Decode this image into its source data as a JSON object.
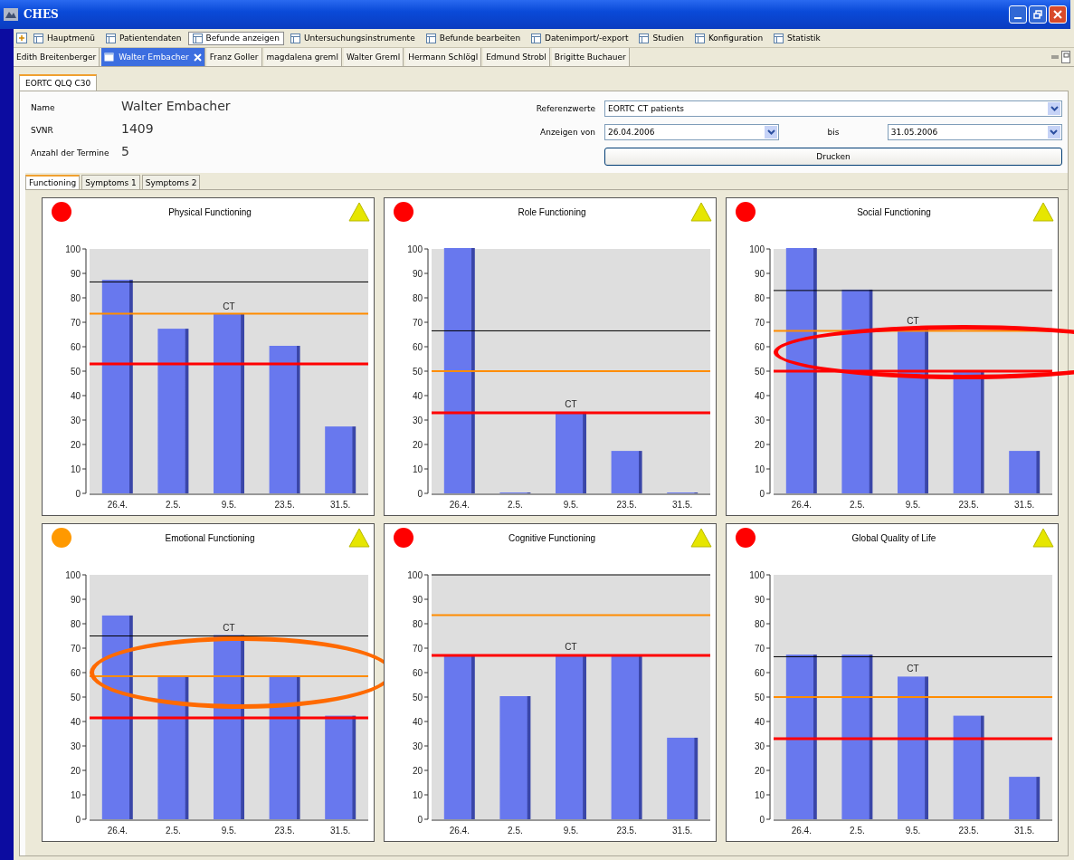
{
  "window": {
    "title": "CHES"
  },
  "toolbar": [
    {
      "label": "Hauptmenü",
      "selected": false
    },
    {
      "label": "Patientendaten",
      "selected": false
    },
    {
      "label": "Befunde anzeigen",
      "selected": true
    },
    {
      "label": "Untersuchungsinstrumente",
      "selected": false
    },
    {
      "label": "Befunde bearbeiten",
      "selected": false
    },
    {
      "label": "Datenimport/-export",
      "selected": false
    },
    {
      "label": "Studien",
      "selected": false
    },
    {
      "label": "Konfiguration",
      "selected": false
    },
    {
      "label": "Statistik",
      "selected": false
    }
  ],
  "patient_tabs": [
    {
      "label": "Edith Breitenberger",
      "selected": false
    },
    {
      "label": "Walter Embacher",
      "selected": true
    },
    {
      "label": "Franz Goller",
      "selected": false
    },
    {
      "label": "magdalena greml",
      "selected": false
    },
    {
      "label": "Walter Greml",
      "selected": false
    },
    {
      "label": "Hermann Schlögl",
      "selected": false
    },
    {
      "label": "Edmund Strobl",
      "selected": false
    },
    {
      "label": "Brigitte Buchauer",
      "selected": false
    }
  ],
  "document_tab": {
    "label": "EORTC QLQ C30"
  },
  "patient_fields": [
    {
      "label": "Name",
      "value": "Walter Embacher"
    },
    {
      "label": "SVNR",
      "value": "1409"
    },
    {
      "label": "Anzahl der Termine",
      "value": "5"
    }
  ],
  "filters": {
    "reference": {
      "label": "Referenzwerte",
      "value": "EORTC CT patients"
    },
    "from": {
      "label": "Anzeigen von",
      "value": "26.04.2006"
    },
    "to": {
      "label": "bis",
      "value": "31.05.2006"
    },
    "print_button": "Drucken"
  },
  "sub_tabs": [
    {
      "label": "Functioning",
      "selected": true
    },
    {
      "label": "Symptoms 1",
      "selected": false
    },
    {
      "label": "Symptoms 2",
      "selected": false
    }
  ],
  "charts": [
    {
      "color": "#ff0000",
      "chart_data": {
        "type": "bar",
        "title": "Physical Functioning",
        "categories": [
          "26.4.",
          "2.5.",
          "9.5.",
          "23.5.",
          "31.5."
        ],
        "values": [
          87,
          67,
          73,
          60,
          27
        ],
        "ylim": [
          0,
          100
        ],
        "yticks": [
          0,
          10,
          20,
          30,
          40,
          50,
          60,
          70,
          80,
          90,
          100
        ],
        "ref_lines": [
          {
            "axis": "y",
            "value": 86.5,
            "color": "#000000"
          },
          {
            "axis": "y",
            "value": 73.5,
            "color": "#ff8c00"
          },
          {
            "axis": "y",
            "value": 53,
            "color": "#ff0000"
          }
        ],
        "annotations": [
          {
            "x": "9.5.",
            "y": 73,
            "text": "CT"
          }
        ]
      }
    },
    {
      "color": "#ff0000",
      "chart_data": {
        "type": "bar",
        "title": "Role Functioning",
        "categories": [
          "26.4.",
          "2.5.",
          "9.5.",
          "23.5.",
          "31.5."
        ],
        "values": [
          100,
          0,
          33,
          17,
          0
        ],
        "ylim": [
          0,
          100
        ],
        "yticks": [
          0,
          10,
          20,
          30,
          40,
          50,
          60,
          70,
          80,
          90,
          100
        ],
        "ref_lines": [
          {
            "axis": "y",
            "value": 66.5,
            "color": "#000000"
          },
          {
            "axis": "y",
            "value": 50,
            "color": "#ff8c00"
          },
          {
            "axis": "y",
            "value": 33,
            "color": "#ff0000"
          }
        ],
        "annotations": [
          {
            "x": "9.5.",
            "y": 33,
            "text": "CT"
          }
        ]
      }
    },
    {
      "color": "#ff0000",
      "highlight": {
        "color": "#ff0000"
      },
      "chart_data": {
        "type": "bar",
        "title": "Social Functioning",
        "categories": [
          "26.4.",
          "2.5.",
          "9.5.",
          "23.5.",
          "31.5."
        ],
        "values": [
          100,
          83,
          67,
          50,
          17
        ],
        "ylim": [
          0,
          100
        ],
        "yticks": [
          0,
          10,
          20,
          30,
          40,
          50,
          60,
          70,
          80,
          90,
          100
        ],
        "ref_lines": [
          {
            "axis": "y",
            "value": 83,
            "color": "#000000"
          },
          {
            "axis": "y",
            "value": 66.5,
            "color": "#ff8c00"
          },
          {
            "axis": "y",
            "value": 50,
            "color": "#ff0000"
          }
        ],
        "annotations": [
          {
            "x": "9.5.",
            "y": 67,
            "text": "CT"
          }
        ]
      }
    },
    {
      "color": "#ff9900",
      "highlight": {
        "color": "#ff6a00"
      },
      "chart_data": {
        "type": "bar",
        "title": "Emotional Functioning",
        "categories": [
          "26.4.",
          "2.5.",
          "9.5.",
          "23.5.",
          "31.5."
        ],
        "values": [
          83,
          58,
          75,
          58,
          42
        ],
        "ylim": [
          0,
          100
        ],
        "yticks": [
          0,
          10,
          20,
          30,
          40,
          50,
          60,
          70,
          80,
          90,
          100
        ],
        "ref_lines": [
          {
            "axis": "y",
            "value": 75,
            "color": "#000000"
          },
          {
            "axis": "y",
            "value": 58.5,
            "color": "#ff8c00"
          },
          {
            "axis": "y",
            "value": 41.5,
            "color": "#ff0000"
          }
        ],
        "annotations": [
          {
            "x": "9.5.",
            "y": 75,
            "text": "CT"
          }
        ]
      }
    },
    {
      "color": "#ff0000",
      "chart_data": {
        "type": "bar",
        "title": "Cognitive Functioning",
        "categories": [
          "26.4.",
          "2.5.",
          "9.5.",
          "23.5.",
          "31.5."
        ],
        "values": [
          67,
          50,
          67,
          67,
          33
        ],
        "ylim": [
          0,
          100
        ],
        "yticks": [
          0,
          10,
          20,
          30,
          40,
          50,
          60,
          70,
          80,
          90,
          100
        ],
        "ref_lines": [
          {
            "axis": "y",
            "value": 100,
            "color": "#000000"
          },
          {
            "axis": "y",
            "value": 83.5,
            "color": "#ff8c00"
          },
          {
            "axis": "y",
            "value": 67,
            "color": "#ff0000"
          }
        ],
        "annotations": [
          {
            "x": "9.5.",
            "y": 67,
            "text": "CT"
          }
        ]
      }
    },
    {
      "color": "#ff0000",
      "chart_data": {
        "type": "bar",
        "title": "Global Quality of Life",
        "categories": [
          "26.4.",
          "2.5.",
          "9.5.",
          "23.5.",
          "31.5."
        ],
        "values": [
          67,
          67,
          58,
          42,
          17
        ],
        "ylim": [
          0,
          100
        ],
        "yticks": [
          0,
          10,
          20,
          30,
          40,
          50,
          60,
          70,
          80,
          90,
          100
        ],
        "ref_lines": [
          {
            "axis": "y",
            "value": 66.5,
            "color": "#000000"
          },
          {
            "axis": "y",
            "value": 50,
            "color": "#ff8c00"
          },
          {
            "axis": "y",
            "value": 33,
            "color": "#ff0000"
          }
        ],
        "annotations": [
          {
            "x": "9.5.",
            "y": 58,
            "text": "CT"
          }
        ]
      }
    }
  ]
}
